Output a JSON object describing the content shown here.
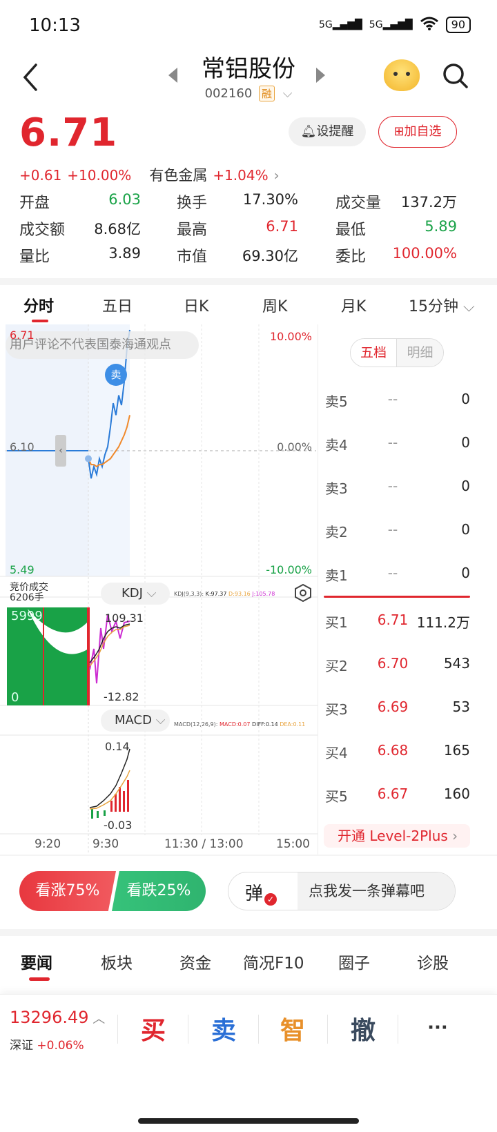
{
  "status_bar": {
    "time": "10:13",
    "signal_1": "5G",
    "signal_2": "5G",
    "battery": "90"
  },
  "header": {
    "title": "常铝股份",
    "code": "002160",
    "margin_badge": "融"
  },
  "quote": {
    "price": "6.71",
    "change": "+0.61",
    "change_pct": "+10.00%",
    "sector": "有色金属",
    "sector_change": "+1.04%",
    "alert_label": "设提醒",
    "watch_label": "加自选"
  },
  "stats": [
    {
      "label": "开盘",
      "value": "6.03",
      "color": "#19a247"
    },
    {
      "label": "换手",
      "value": "17.30%",
      "color": "#222222"
    },
    {
      "label": "成交量",
      "value": "137.2万",
      "color": "#222222"
    },
    {
      "label": "成交额",
      "value": "8.68亿",
      "color": "#222222"
    },
    {
      "label": "最高",
      "value": "6.71",
      "color": "#e0262e"
    },
    {
      "label": "最低",
      "value": "5.89",
      "color": "#19a247"
    },
    {
      "label": "量比",
      "value": "3.89",
      "color": "#222222"
    },
    {
      "label": "市值",
      "value": "69.30亿",
      "color": "#222222"
    },
    {
      "label": "委比",
      "value": "100.00%",
      "color": "#e0262e"
    }
  ],
  "period_tabs": [
    "分时",
    "五日",
    "日K",
    "周K",
    "月K",
    "15分钟"
  ],
  "chart": {
    "disclaimer": "用户评论不代表国泰海通观点",
    "price_high": "6.71",
    "price_mid": "6.10",
    "price_low": "5.49",
    "pct_high": "10.00%",
    "pct_mid": "0.00%",
    "pct_low": "-10.00%",
    "sell_marker": "卖",
    "auction_label": "竞价成交",
    "auction_volume": "6206手",
    "volume_top": "5999",
    "volume_bottom": "0",
    "kdj_label": "KDJ",
    "kdj_params": "KDJ(9,3,3):",
    "kdj_k": "K:97.37",
    "kdj_d": "D:93.16",
    "kdj_j": "J:105.78",
    "kdj_top": "109.31",
    "kdj_bottom": "-12.82",
    "macd_label": "MACD",
    "macd_params": "MACD(12,26,9):",
    "macd_val": "MACD:0.07",
    "macd_diff": "DIFF:0.14",
    "macd_dea": "DEA:0.11",
    "macd_top": "0.14",
    "macd_bottom": "-0.03",
    "time_labels": [
      "9:20",
      "9:30",
      "11:30 / 13:00",
      "15:00"
    ],
    "colors": {
      "price_line": "#2a7bd8",
      "avg_line": "#f0892b",
      "up": "#e0262e",
      "down": "#19a247"
    }
  },
  "chart_data": [
    {
      "type": "line",
      "title": "",
      "ylim": [
        5.49,
        6.71
      ],
      "x": [
        "9:20",
        "9:30",
        "9:31",
        "9:32",
        "9:33",
        "9:34",
        "9:35",
        "9:36",
        "9:37",
        "9:38",
        "9:39",
        "9:40",
        "9:41",
        "9:42",
        "9:43",
        "9:44",
        "9:45"
      ],
      "series": [
        {
          "values": [
            6.1,
            6.06,
            5.96,
            6.02,
            5.98,
            6.06,
            6.02,
            6.08,
            6.12,
            6.22,
            6.34,
            6.28,
            6.38,
            6.33,
            6.45,
            6.62,
            6.71
          ]
        },
        {
          "values": [
            6.1,
            6.06,
            6.03,
            6.03,
            6.02,
            6.03,
            6.03,
            6.04,
            6.05,
            6.06,
            6.08,
            6.1,
            6.12,
            6.15,
            6.18,
            6.22,
            6.28
          ]
        }
      ]
    }
  ],
  "order_book": {
    "tabs": [
      "五档",
      "明细"
    ],
    "asks": [
      {
        "label": "卖5",
        "price": "--",
        "volume": "0"
      },
      {
        "label": "卖4",
        "price": "--",
        "volume": "0"
      },
      {
        "label": "卖3",
        "price": "--",
        "volume": "0"
      },
      {
        "label": "卖2",
        "price": "--",
        "volume": "0"
      },
      {
        "label": "卖1",
        "price": "--",
        "volume": "0"
      }
    ],
    "bids": [
      {
        "label": "买1",
        "price": "6.71",
        "volume": "111.2万"
      },
      {
        "label": "买2",
        "price": "6.70",
        "volume": "543"
      },
      {
        "label": "买3",
        "price": "6.69",
        "volume": "53"
      },
      {
        "label": "买4",
        "price": "6.68",
        "volume": "165"
      },
      {
        "label": "买5",
        "price": "6.67",
        "volume": "160"
      }
    ],
    "level2_promo": "开通 Level-2Plus"
  },
  "sentiment": {
    "bull": "看涨75%",
    "bear": "看跌25%",
    "danmu_icon": "弹",
    "danmu_placeholder": "点我发一条弹幕吧",
    "bull_pct": 75
  },
  "news_tabs": [
    "要闻",
    "板块",
    "资金",
    "简况F10",
    "圈子",
    "诊股"
  ],
  "bottom_bar": {
    "index_value": "13296.49",
    "index_name": "深证",
    "index_change": "+0.06%",
    "buy": "买",
    "sell": "卖",
    "smart": "智",
    "cancel": "撤",
    "more": "···"
  }
}
